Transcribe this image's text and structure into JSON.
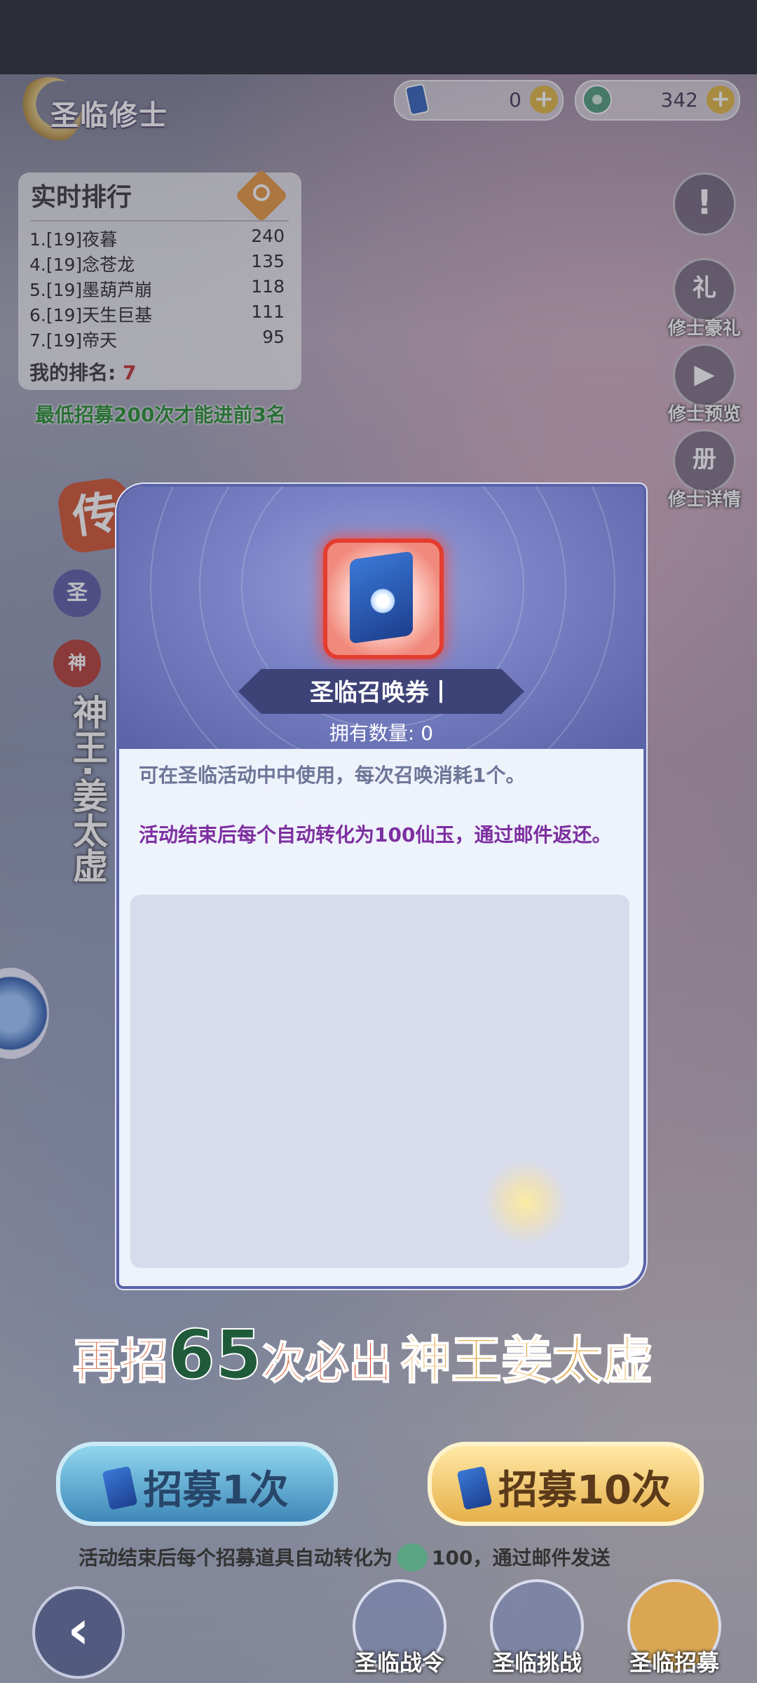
{
  "header": {
    "title": "圣临修士",
    "resources": [
      {
        "icon": "summon-ticket-icon",
        "value": "0"
      },
      {
        "icon": "jade-coin-icon",
        "value": "342"
      }
    ],
    "plus_symbol": "+"
  },
  "leaderboard": {
    "title": "实时排行",
    "rows": [
      {
        "name": "1.[19]夜暮",
        "score": "240"
      },
      {
        "name": "4.[19]念苍龙",
        "score": "135"
      },
      {
        "name": "5.[19]墨葫芦崩",
        "score": "118"
      },
      {
        "name": "6.[19]天生巨基",
        "score": "111"
      },
      {
        "name": "7.[19]帝天",
        "score": "95"
      }
    ],
    "my_rank_label": "我的排名:",
    "my_rank_value": "7",
    "hint": "最低招募200次才能进前3名"
  },
  "right_buttons": [
    {
      "icon": "exclamation-icon",
      "label": "",
      "glyph": "!"
    },
    {
      "icon": "gift-bag-icon",
      "label": "修士豪礼",
      "glyph": "礼"
    },
    {
      "icon": "play-icon",
      "label": "修士预览",
      "glyph": "▶"
    },
    {
      "icon": "book-icon",
      "label": "修士详情",
      "glyph": "册"
    }
  ],
  "hero": {
    "legend_badge": "传",
    "badge1": "圣",
    "badge2": "神",
    "name": "神王·姜太虚"
  },
  "modal": {
    "item_name": "圣临召唤券丨",
    "owned_label": "拥有数量: 0",
    "description": "可在圣临活动中中使用，每次召唤消耗1个。",
    "note": "活动结束后每个自动转化为100仙玉，通过邮件返还。"
  },
  "promo": {
    "prefix": "再招",
    "count": "65",
    "middle": "次必出",
    "hero": "神王姜太虚"
  },
  "actions": {
    "recruit_once": "招募1次",
    "recruit_ten": "招募10次"
  },
  "footnote": {
    "before": "活动结束后每个招募道具自动转化为",
    "amount": "100",
    "after": "，通过邮件发送"
  },
  "bottom_nav": [
    {
      "label": "圣临战令",
      "icon": "sword-banner-icon"
    },
    {
      "label": "圣临挑战",
      "icon": "challenge-icon"
    },
    {
      "label": "圣临招募",
      "icon": "recruit-icon"
    }
  ],
  "back_glyph": "‹"
}
